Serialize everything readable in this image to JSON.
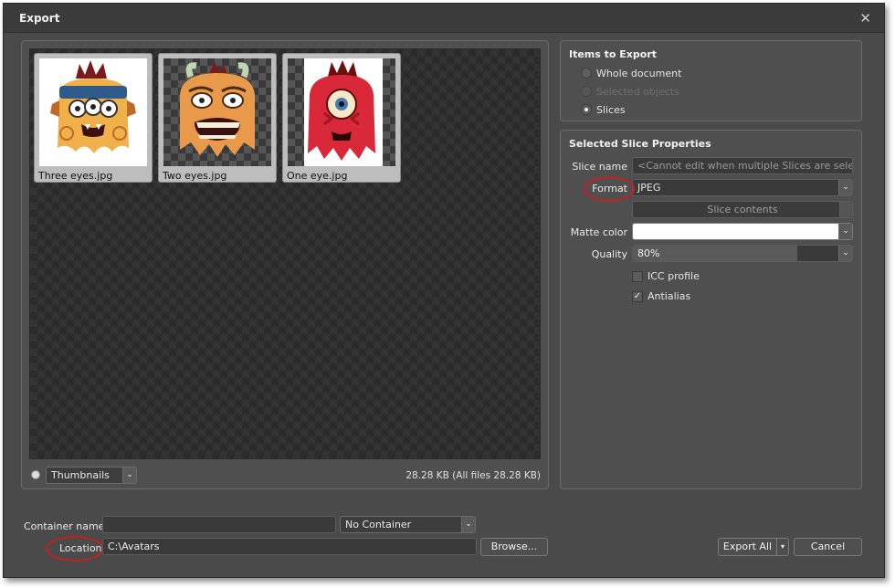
{
  "window": {
    "title": "Export",
    "close_icon": "close-icon"
  },
  "preview": {
    "thumbnails": [
      {
        "caption": "Three eyes.jpg"
      },
      {
        "caption": "Two eyes.jpg"
      },
      {
        "caption": "One eye.jpg"
      }
    ],
    "view_mode": "Thumbnails",
    "size_info": "28.28 KB (All files 28.28 KB)"
  },
  "items_to_export": {
    "title": "Items to Export",
    "options": [
      {
        "label": "Whole document",
        "selected": false,
        "enabled": true
      },
      {
        "label": "Selected objects",
        "selected": false,
        "enabled": false
      },
      {
        "label": "Slices",
        "selected": true,
        "enabled": true
      }
    ]
  },
  "slice_properties": {
    "title": "Selected Slice Properties",
    "slice_name_label": "Slice name",
    "slice_name_placeholder": "<Cannot edit when multiple Slices are selec...",
    "format_label": "Format",
    "format_value": "JPEG",
    "slice_contents_label": "Slice contents",
    "matte_label": "Matte color",
    "matte_color": "#ffffff",
    "quality_label": "Quality",
    "quality_value": "80%",
    "quality_level": 0.8,
    "icc_label": "ICC profile",
    "icc_checked": false,
    "antialias_label": "Antialias",
    "antialias_checked": true
  },
  "bottom": {
    "container_label": "Container name",
    "container_value": "",
    "container_type": "No Container",
    "location_label": "Location",
    "location_value": "C:\\Avatars",
    "browse_label": "Browse...",
    "export_label": "Export All",
    "cancel_label": "Cancel"
  },
  "colors": {
    "dialog_bg": "#4a4a4a",
    "highlight_ellipse": "#c81e1e"
  }
}
